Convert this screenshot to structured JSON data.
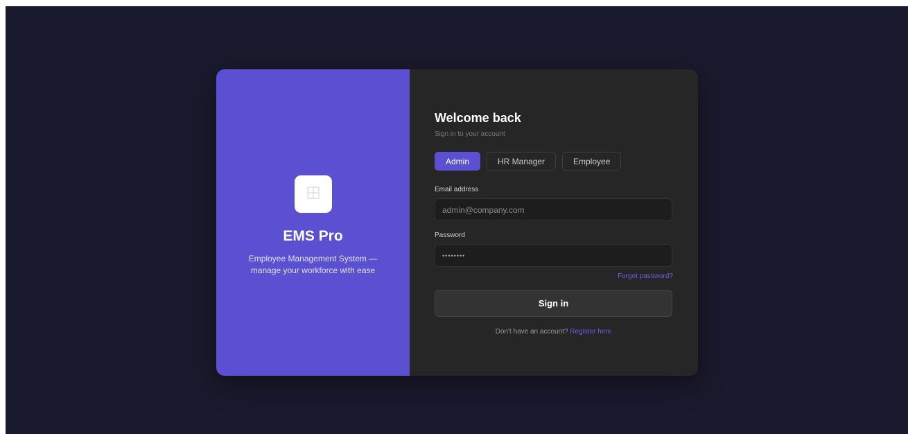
{
  "brand": {
    "name": "EMS Pro",
    "tagline": "Employee Management System — manage your workforce with ease",
    "logo_icon": "grid-icon",
    "accent_color": "#5b50d1"
  },
  "login": {
    "title": "Welcome back",
    "subtitle": "Sign in to your account",
    "roles": [
      {
        "label": "Admin",
        "active": true
      },
      {
        "label": "HR Manager",
        "active": false
      },
      {
        "label": "Employee",
        "active": false
      }
    ],
    "email_label": "Email address",
    "email_placeholder": "admin@company.com",
    "password_label": "Password",
    "password_value": "••••••••",
    "forgot_label": "Forgot password?",
    "signin_label": "Sign in",
    "register_prompt": "Don't have an account?",
    "register_link": "Register here"
  }
}
